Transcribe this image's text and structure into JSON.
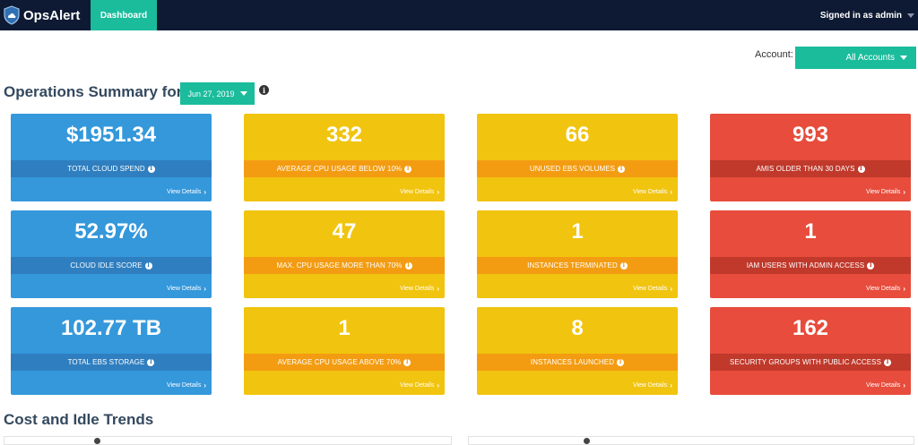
{
  "app": {
    "name": "OpsAlert",
    "logo_icon": "shield-cloud-icon"
  },
  "nav": {
    "tabs": [
      {
        "label": "Dashboard",
        "active": true
      }
    ]
  },
  "user": {
    "label": "Signed in as admin"
  },
  "account": {
    "label": "Account:",
    "selected": "All Accounts"
  },
  "summary": {
    "title": "Operations Summary for",
    "date": "Jun 27, 2019",
    "info_glyph": "i"
  },
  "view_details": "View Details",
  "cards": [
    {
      "value": "$1951.34",
      "label": "TOTAL CLOUD SPEND",
      "color": "blue"
    },
    {
      "value": "332",
      "label": "AVERAGE CPU USAGE BELOW 10%",
      "color": "yellow"
    },
    {
      "value": "66",
      "label": "UNUSED EBS VOLUMES",
      "color": "yellow"
    },
    {
      "value": "993",
      "label": "AMIS OLDER THAN 30 DAYS",
      "color": "red"
    },
    {
      "value": "52.97%",
      "label": "CLOUD IDLE SCORE",
      "color": "blue"
    },
    {
      "value": "47",
      "label": "MAX. CPU USAGE MORE THAN 70%",
      "color": "yellow"
    },
    {
      "value": "1",
      "label": "INSTANCES TERMINATED",
      "color": "yellow"
    },
    {
      "value": "1",
      "label": "IAM USERS WITH ADMIN ACCESS",
      "color": "red"
    },
    {
      "value": "102.77 TB",
      "label": "TOTAL EBS STORAGE",
      "color": "blue"
    },
    {
      "value": "1",
      "label": "AVERAGE CPU USAGE ABOVE 70%",
      "color": "yellow"
    },
    {
      "value": "8",
      "label": "INSTANCES LAUNCHED",
      "color": "yellow"
    },
    {
      "value": "162",
      "label": "SECURITY GROUPS WITH PUBLIC ACCESS",
      "color": "red"
    }
  ],
  "colors": {
    "accent": "#1abc9c",
    "navbar": "#0e1a33",
    "blue": "#3498db",
    "yellow": "#f1c40f",
    "red": "#e74c3c"
  },
  "trends": {
    "title": "Cost and Idle Trends"
  }
}
